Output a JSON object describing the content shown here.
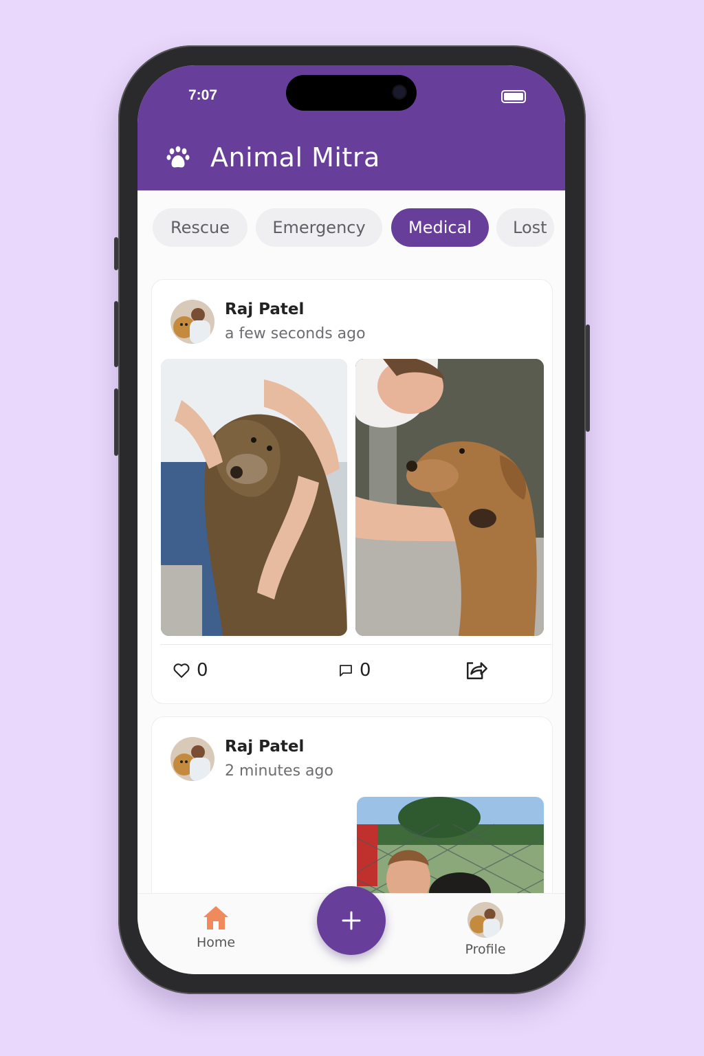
{
  "status_bar": {
    "time": "7:07"
  },
  "app": {
    "title": "Animal Mitra",
    "logo_icon": "paw-icon",
    "brand_color": "#673f9b"
  },
  "filters": {
    "chips": [
      {
        "label": "Rescue",
        "active": false
      },
      {
        "label": "Emergency",
        "active": false
      },
      {
        "label": "Medical",
        "active": true
      },
      {
        "label": "Lost",
        "active": false
      }
    ]
  },
  "posts": [
    {
      "user_name": "Raj Patel",
      "time_ago": "a few seconds ago",
      "likes": "0",
      "comments": "0",
      "photos": [
        "dog-hug-photo",
        "dog-paw-photo"
      ]
    },
    {
      "user_name": "Raj Patel",
      "time_ago": "2 minutes ago",
      "photos": [
        "boy-with-dog-photo"
      ]
    }
  ],
  "bottom_nav": {
    "home_label": "Home",
    "profile_label": "Profile",
    "fab_icon": "plus-icon",
    "home_color": "#f08a5d"
  }
}
